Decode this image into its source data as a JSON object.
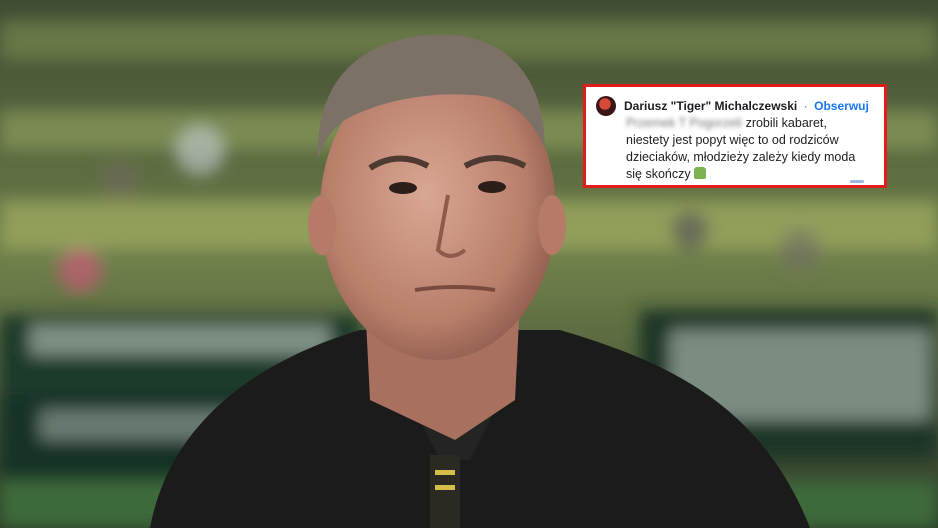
{
  "comment": {
    "author": "Dariusz \"Tiger\" Michalczewski",
    "separator": "·",
    "follow_label": "Obserwuj",
    "blurred_name": "Przemek T Pogorzeli",
    "line1": "zrobili kabaret,",
    "line2": "niestety jest popyt więc to od rodziców",
    "line3": "dzieciaków, młodzieży zależy kiedy moda",
    "line4": "się skończy",
    "emoji_icon": "man-shrugging-icon"
  },
  "colors": {
    "highlight_border": "#e21b1b",
    "link_blue": "#1877f2"
  }
}
